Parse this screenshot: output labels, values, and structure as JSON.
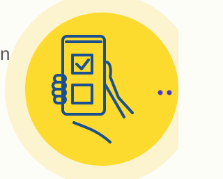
{
  "clipped_text": "n",
  "colors": {
    "outer_ring": "#FCF3CF",
    "inner_circle": "#FCDB2E",
    "stroke": "#1A4F91",
    "connector": "#4B38C9",
    "dots": "#4B38C9",
    "background": "#FDFDF8",
    "text": "#555555"
  },
  "icon": "phone-checklist-hand-icon"
}
